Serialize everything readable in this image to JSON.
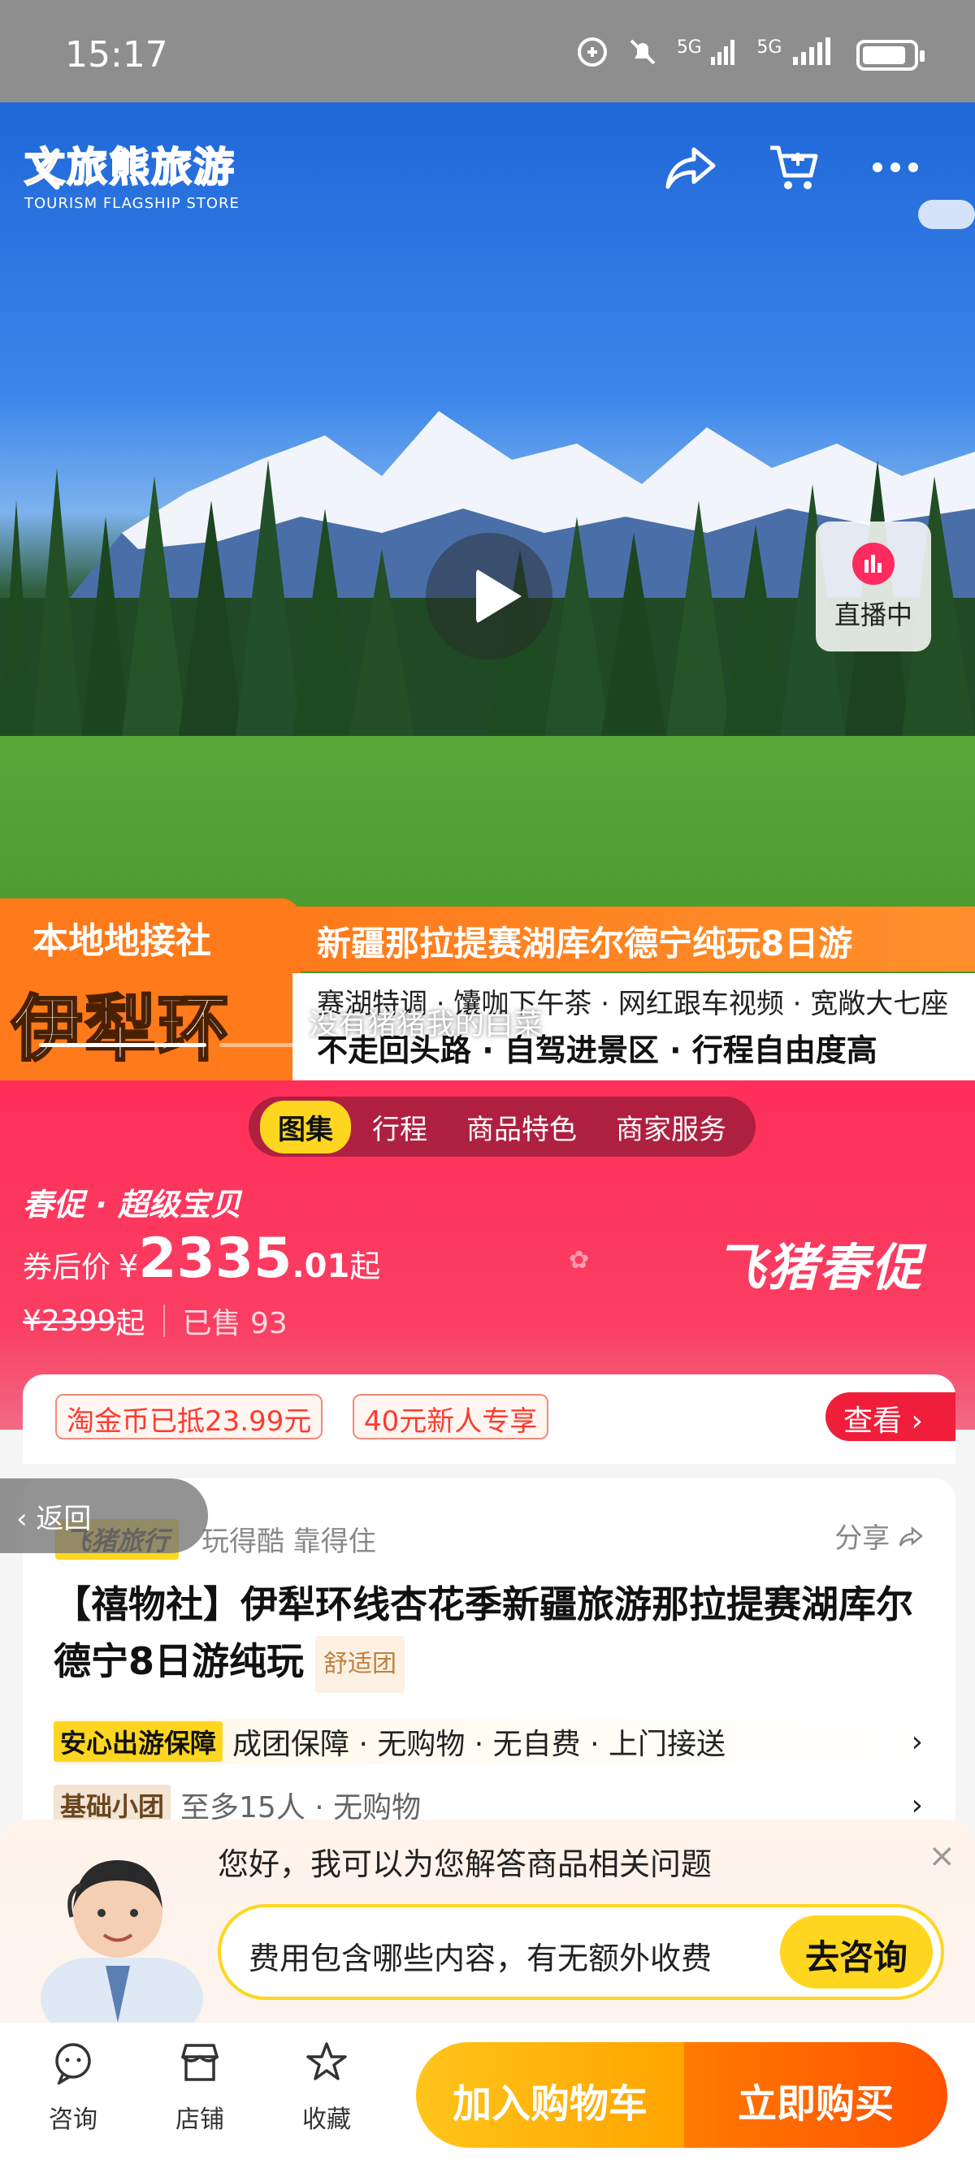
{
  "status_bar": {
    "time": "15:17",
    "network1": "5G",
    "network2": "5G"
  },
  "hero": {
    "brand_name": "文旅熊旅游",
    "brand_sub": "TOURISM FLAGSHIP STORE",
    "live_label": "直播中",
    "banner_left_top": "本地地接社",
    "banner_left_big": "伊犁环线",
    "banner_title": "新疆那拉提赛湖库尔德宁纯玩8日游",
    "banner_line1": "赛湖特调 · 馕咖下午茶 · 网红跟车视频 · 宽敞大七座",
    "banner_line2": "不走回头路 · 自驾进景区 · 行程自由度高",
    "overlay_caption": "没有猪猪我的白菜"
  },
  "tabs": [
    "图集",
    "行程",
    "商品特色",
    "商家服务"
  ],
  "promo": {
    "tag": "春促 · 超级宝贝",
    "price_label": "券后价",
    "currency": "¥",
    "price_int": "2335",
    "price_dec": ".01",
    "price_unit": "起",
    "orig_price": "¥2399",
    "orig_unit": "起",
    "sold": "已售 93",
    "fliggy_promo": "飞猪春促"
  },
  "coupons": {
    "c1": "淘金币已抵23.99元",
    "c2": "40元新人专享",
    "view": "查看 ›"
  },
  "card": {
    "logo": "飞猪旅行",
    "slogan": "玩得酷 靠得住",
    "share": "分享",
    "title": "【禧物社】伊犁环线杏花季新疆旅游那拉提赛湖库尔德宁8日游纯玩",
    "comfort": "舒适团",
    "guarantee_badge": "安心出游保障",
    "guarantee_text": "成团保障 · 无购物 · 无自费 · 上门接送",
    "group_badge": "基础小团",
    "group_text": "至多15人 · 无购物"
  },
  "back_float": "返回",
  "assistant": {
    "question": "您好，我可以为您解答商品相关问题",
    "suggest": "费用包含哪些内容，有无额外收费",
    "ask_button": "去咨询",
    "close": "×"
  },
  "bottom_nav": {
    "consult": "咨询",
    "store": "店铺",
    "favorite": "收藏",
    "add_cart": "加入购物车",
    "buy_now": "立即购买"
  },
  "colors": {
    "promo_pink": "#ff2f59",
    "accent_yellow": "#ffd61f",
    "buy_orange": "#ff5200"
  }
}
